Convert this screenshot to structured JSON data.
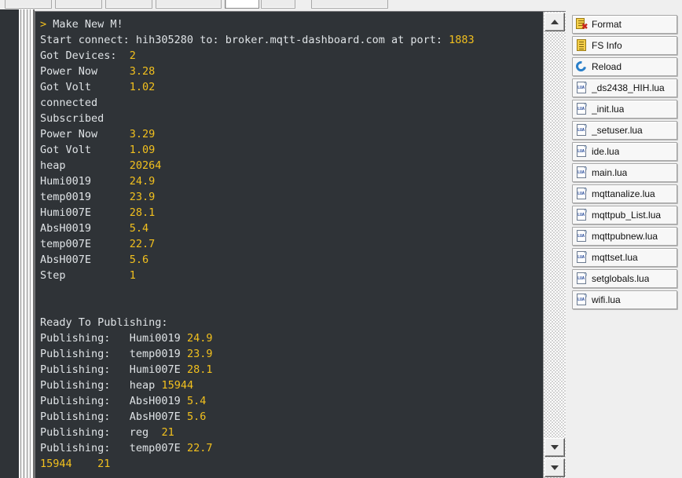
{
  "toolbar": {
    "buttons": [
      {
        "name": "toolbar-button-1",
        "style": "plain"
      },
      {
        "name": "toolbar-button-2",
        "style": "plain"
      },
      {
        "name": "toolbar-button-3",
        "style": "plain"
      },
      {
        "name": "toolbar-button-4",
        "style": "sunken"
      },
      {
        "name": "toolbar-button-5",
        "style": "plain"
      }
    ]
  },
  "console": {
    "prompt_symbol": ">",
    "lines": [
      {
        "segments": [
          {
            "text": "> ",
            "color": "yellow"
          },
          {
            "text": "Make New M!",
            "color": "white"
          }
        ]
      },
      {
        "segments": [
          {
            "text": "Start connect: hih305280 to: broker.mqtt-dashboard.com at port: ",
            "color": "white"
          },
          {
            "text": "1883",
            "color": "yellow"
          }
        ]
      },
      {
        "segments": [
          {
            "text": "Got Devices:  ",
            "color": "white"
          },
          {
            "text": "2",
            "color": "yellow"
          }
        ]
      },
      {
        "segments": [
          {
            "text": "Power Now     ",
            "color": "white"
          },
          {
            "text": "3.28",
            "color": "yellow"
          }
        ]
      },
      {
        "segments": [
          {
            "text": "Got Volt      ",
            "color": "white"
          },
          {
            "text": "1.02",
            "color": "yellow"
          }
        ]
      },
      {
        "segments": [
          {
            "text": "connected",
            "color": "white"
          }
        ]
      },
      {
        "segments": [
          {
            "text": "Subscribed",
            "color": "white"
          }
        ]
      },
      {
        "segments": [
          {
            "text": "Power Now     ",
            "color": "white"
          },
          {
            "text": "3.29",
            "color": "yellow"
          }
        ]
      },
      {
        "segments": [
          {
            "text": "Got Volt      ",
            "color": "white"
          },
          {
            "text": "1.09",
            "color": "yellow"
          }
        ]
      },
      {
        "segments": [
          {
            "text": "heap          ",
            "color": "white"
          },
          {
            "text": "20264",
            "color": "yellow"
          }
        ]
      },
      {
        "segments": [
          {
            "text": "Humi0019      ",
            "color": "white"
          },
          {
            "text": "24.9",
            "color": "yellow"
          }
        ]
      },
      {
        "segments": [
          {
            "text": "temp0019      ",
            "color": "white"
          },
          {
            "text": "23.9",
            "color": "yellow"
          }
        ]
      },
      {
        "segments": [
          {
            "text": "Humi007E      ",
            "color": "white"
          },
          {
            "text": "28.1",
            "color": "yellow"
          }
        ]
      },
      {
        "segments": [
          {
            "text": "AbsH0019      ",
            "color": "white"
          },
          {
            "text": "5.4",
            "color": "yellow"
          }
        ]
      },
      {
        "segments": [
          {
            "text": "temp007E      ",
            "color": "white"
          },
          {
            "text": "22.7",
            "color": "yellow"
          }
        ]
      },
      {
        "segments": [
          {
            "text": "AbsH007E      ",
            "color": "white"
          },
          {
            "text": "5.6",
            "color": "yellow"
          }
        ]
      },
      {
        "segments": [
          {
            "text": "Step          ",
            "color": "white"
          },
          {
            "text": "1",
            "color": "yellow"
          }
        ]
      },
      {
        "segments": []
      },
      {
        "segments": []
      },
      {
        "segments": [
          {
            "text": "Ready To Publishing:",
            "color": "white"
          }
        ]
      },
      {
        "segments": [
          {
            "text": "Publishing:   Humi0019 ",
            "color": "white"
          },
          {
            "text": "24.9",
            "color": "yellow"
          }
        ]
      },
      {
        "segments": [
          {
            "text": "Publishing:   temp0019 ",
            "color": "white"
          },
          {
            "text": "23.9",
            "color": "yellow"
          }
        ]
      },
      {
        "segments": [
          {
            "text": "Publishing:   Humi007E ",
            "color": "white"
          },
          {
            "text": "28.1",
            "color": "yellow"
          }
        ]
      },
      {
        "segments": [
          {
            "text": "Publishing:   heap ",
            "color": "white"
          },
          {
            "text": "15944",
            "color": "yellow"
          }
        ]
      },
      {
        "segments": [
          {
            "text": "Publishing:   AbsH0019 ",
            "color": "white"
          },
          {
            "text": "5.4",
            "color": "yellow"
          }
        ]
      },
      {
        "segments": [
          {
            "text": "Publishing:   AbsH007E ",
            "color": "white"
          },
          {
            "text": "5.6",
            "color": "yellow"
          }
        ]
      },
      {
        "segments": [
          {
            "text": "Publishing:   reg  ",
            "color": "white"
          },
          {
            "text": "21",
            "color": "yellow"
          }
        ]
      },
      {
        "segments": [
          {
            "text": "Publishing:   temp007E ",
            "color": "white"
          },
          {
            "text": "22.7",
            "color": "yellow"
          }
        ]
      },
      {
        "segments": [
          {
            "text": "15944    21",
            "color": "yellow"
          }
        ]
      }
    ]
  },
  "scrollbar": {
    "up_arrow": "scroll-up-arrow",
    "down_arrow": "scroll-down-arrow"
  },
  "sidebar": {
    "items": [
      {
        "label": "Format",
        "icon": "format-icon",
        "type": "action"
      },
      {
        "label": "FS Info",
        "icon": "fs-info-icon",
        "type": "action"
      },
      {
        "label": "Reload",
        "icon": "reload-icon",
        "type": "action"
      },
      {
        "label": "_ds2438_HIH.lua",
        "icon": "lua-file-icon",
        "type": "file"
      },
      {
        "label": "_init.lua",
        "icon": "lua-file-icon",
        "type": "file"
      },
      {
        "label": "_setuser.lua",
        "icon": "lua-file-icon",
        "type": "file"
      },
      {
        "label": "ide.lua",
        "icon": "lua-file-icon",
        "type": "file"
      },
      {
        "label": "main.lua",
        "icon": "lua-file-icon",
        "type": "file"
      },
      {
        "label": "mqttanalize.lua",
        "icon": "lua-file-icon",
        "type": "file"
      },
      {
        "label": "mqttpub_List.lua",
        "icon": "lua-file-icon",
        "type": "file"
      },
      {
        "label": "mqttpubnew.lua",
        "icon": "lua-file-icon",
        "type": "file"
      },
      {
        "label": "mqttset.lua",
        "icon": "lua-file-icon",
        "type": "file"
      },
      {
        "label": "setglobals.lua",
        "icon": "lua-file-icon",
        "type": "file"
      },
      {
        "label": "wifi.lua",
        "icon": "lua-file-icon",
        "type": "file"
      }
    ],
    "lua_tag": "LUA"
  },
  "colors": {
    "console_bg": "#2f3337",
    "console_text": "#dfe3e6",
    "console_value": "#f2c01e",
    "chrome_bg": "#efefef"
  }
}
